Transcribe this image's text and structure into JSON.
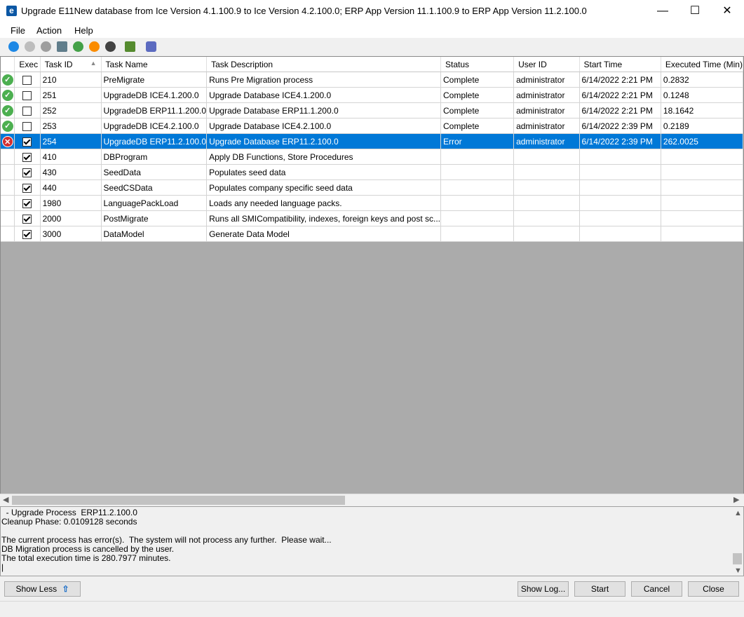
{
  "window": {
    "title": "Upgrade E11New database from Ice Version 4.1.100.9 to Ice Version 4.2.100.0;  ERP App Version 11.1.100.9 to ERP App Version 11.2.100.0",
    "app_icon": "e",
    "minimize": "—",
    "maximize": "☐",
    "close": "✕"
  },
  "menu": {
    "file": "File",
    "action": "Action",
    "help": "Help"
  },
  "toolbar": {
    "icons": [
      "run-icon",
      "stop-icon",
      "settings-icon",
      "document-icon",
      "check-icon",
      "refresh-icon",
      "info-icon",
      "export-icon",
      "database-icon"
    ]
  },
  "grid": {
    "columns": {
      "exec": "Exec",
      "task_id": "Task ID",
      "task_name": "Task Name",
      "task_description": "Task Description",
      "status": "Status",
      "user_id": "User ID",
      "start_time": "Start Time",
      "executed_time": "Executed Time (Min)"
    },
    "rows": [
      {
        "state": "ok",
        "exec": false,
        "task_id": "210",
        "task_name": "PreMigrate",
        "task_description": "Runs Pre Migration process",
        "status": "Complete",
        "user_id": "administrator",
        "start_time": "6/14/2022 2:21 PM",
        "executed_time": "0.2832"
      },
      {
        "state": "ok",
        "exec": false,
        "task_id": "251",
        "task_name": "UpgradeDB ICE4.1.200.0",
        "task_description": "Upgrade Database ICE4.1.200.0",
        "status": "Complete",
        "user_id": "administrator",
        "start_time": "6/14/2022 2:21 PM",
        "executed_time": "0.1248"
      },
      {
        "state": "ok",
        "exec": false,
        "task_id": "252",
        "task_name": "UpgradeDB ERP11.1.200.0",
        "task_description": "Upgrade Database ERP11.1.200.0",
        "status": "Complete",
        "user_id": "administrator",
        "start_time": "6/14/2022 2:21 PM",
        "executed_time": "18.1642"
      },
      {
        "state": "ok",
        "exec": false,
        "task_id": "253",
        "task_name": "UpgradeDB ICE4.2.100.0",
        "task_description": "Upgrade Database ICE4.2.100.0",
        "status": "Complete",
        "user_id": "administrator",
        "start_time": "6/14/2022 2:39 PM",
        "executed_time": "0.2189"
      },
      {
        "state": "error",
        "exec": true,
        "task_id": "254",
        "task_name": "UpgradeDB ERP11.2.100.0",
        "task_description": "Upgrade Database ERP11.2.100.0",
        "status": "Error",
        "user_id": "administrator",
        "start_time": "6/14/2022 2:39 PM",
        "executed_time": "262.0025"
      },
      {
        "state": "",
        "exec": true,
        "task_id": "410",
        "task_name": "DBProgram",
        "task_description": "Apply DB Functions, Store Procedures",
        "status": "",
        "user_id": "",
        "start_time": "",
        "executed_time": ""
      },
      {
        "state": "",
        "exec": true,
        "task_id": "430",
        "task_name": "SeedData",
        "task_description": "Populates seed data",
        "status": "",
        "user_id": "",
        "start_time": "",
        "executed_time": ""
      },
      {
        "state": "",
        "exec": true,
        "task_id": "440",
        "task_name": "SeedCSData",
        "task_description": "Populates company specific seed data",
        "status": "",
        "user_id": "",
        "start_time": "",
        "executed_time": ""
      },
      {
        "state": "",
        "exec": true,
        "task_id": "1980",
        "task_name": "LanguagePackLoad",
        "task_description": "Loads any needed language packs.",
        "status": "",
        "user_id": "",
        "start_time": "",
        "executed_time": ""
      },
      {
        "state": "",
        "exec": true,
        "task_id": "2000",
        "task_name": "PostMigrate",
        "task_description": "Runs all SMICompatibility, indexes, foreign keys and post sc...",
        "status": "",
        "user_id": "",
        "start_time": "",
        "executed_time": ""
      },
      {
        "state": "",
        "exec": true,
        "task_id": "3000",
        "task_name": "DataModel",
        "task_description": "Generate Data Model",
        "status": "",
        "user_id": "",
        "start_time": "",
        "executed_time": ""
      }
    ]
  },
  "log": {
    "lines": [
      "  - Upgrade Process  ERP11.2.100.0",
      "Cleanup Phase: 0.0109128 seconds",
      "",
      "The current process has error(s).  The system will not process any further.  Please wait...",
      "DB Migration process is cancelled by the user.",
      "The total execution time is 280.7977 minutes.",
      "|"
    ]
  },
  "buttons": {
    "show_less": "Show Less",
    "show_log": "Show Log...",
    "start": "Start",
    "cancel": "Cancel",
    "close": "Close"
  }
}
